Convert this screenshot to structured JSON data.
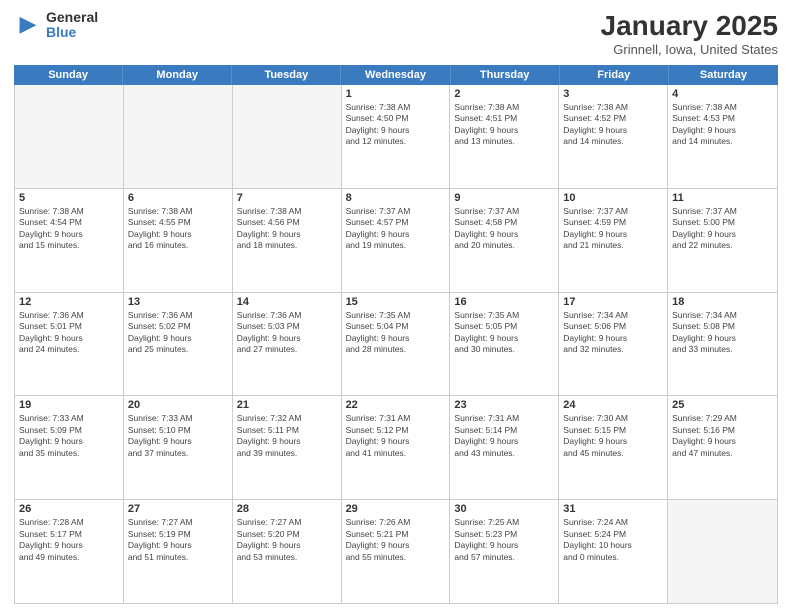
{
  "logo": {
    "general": "General",
    "blue": "Blue"
  },
  "title": "January 2025",
  "subtitle": "Grinnell, Iowa, United States",
  "days": [
    "Sunday",
    "Monday",
    "Tuesday",
    "Wednesday",
    "Thursday",
    "Friday",
    "Saturday"
  ],
  "weeks": [
    [
      {
        "date": "",
        "info": ""
      },
      {
        "date": "",
        "info": ""
      },
      {
        "date": "",
        "info": ""
      },
      {
        "date": "1",
        "info": "Sunrise: 7:38 AM\nSunset: 4:50 PM\nDaylight: 9 hours\nand 12 minutes."
      },
      {
        "date": "2",
        "info": "Sunrise: 7:38 AM\nSunset: 4:51 PM\nDaylight: 9 hours\nand 13 minutes."
      },
      {
        "date": "3",
        "info": "Sunrise: 7:38 AM\nSunset: 4:52 PM\nDaylight: 9 hours\nand 14 minutes."
      },
      {
        "date": "4",
        "info": "Sunrise: 7:38 AM\nSunset: 4:53 PM\nDaylight: 9 hours\nand 14 minutes."
      }
    ],
    [
      {
        "date": "5",
        "info": "Sunrise: 7:38 AM\nSunset: 4:54 PM\nDaylight: 9 hours\nand 15 minutes."
      },
      {
        "date": "6",
        "info": "Sunrise: 7:38 AM\nSunset: 4:55 PM\nDaylight: 9 hours\nand 16 minutes."
      },
      {
        "date": "7",
        "info": "Sunrise: 7:38 AM\nSunset: 4:56 PM\nDaylight: 9 hours\nand 18 minutes."
      },
      {
        "date": "8",
        "info": "Sunrise: 7:37 AM\nSunset: 4:57 PM\nDaylight: 9 hours\nand 19 minutes."
      },
      {
        "date": "9",
        "info": "Sunrise: 7:37 AM\nSunset: 4:58 PM\nDaylight: 9 hours\nand 20 minutes."
      },
      {
        "date": "10",
        "info": "Sunrise: 7:37 AM\nSunset: 4:59 PM\nDaylight: 9 hours\nand 21 minutes."
      },
      {
        "date": "11",
        "info": "Sunrise: 7:37 AM\nSunset: 5:00 PM\nDaylight: 9 hours\nand 22 minutes."
      }
    ],
    [
      {
        "date": "12",
        "info": "Sunrise: 7:36 AM\nSunset: 5:01 PM\nDaylight: 9 hours\nand 24 minutes."
      },
      {
        "date": "13",
        "info": "Sunrise: 7:36 AM\nSunset: 5:02 PM\nDaylight: 9 hours\nand 25 minutes."
      },
      {
        "date": "14",
        "info": "Sunrise: 7:36 AM\nSunset: 5:03 PM\nDaylight: 9 hours\nand 27 minutes."
      },
      {
        "date": "15",
        "info": "Sunrise: 7:35 AM\nSunset: 5:04 PM\nDaylight: 9 hours\nand 28 minutes."
      },
      {
        "date": "16",
        "info": "Sunrise: 7:35 AM\nSunset: 5:05 PM\nDaylight: 9 hours\nand 30 minutes."
      },
      {
        "date": "17",
        "info": "Sunrise: 7:34 AM\nSunset: 5:06 PM\nDaylight: 9 hours\nand 32 minutes."
      },
      {
        "date": "18",
        "info": "Sunrise: 7:34 AM\nSunset: 5:08 PM\nDaylight: 9 hours\nand 33 minutes."
      }
    ],
    [
      {
        "date": "19",
        "info": "Sunrise: 7:33 AM\nSunset: 5:09 PM\nDaylight: 9 hours\nand 35 minutes."
      },
      {
        "date": "20",
        "info": "Sunrise: 7:33 AM\nSunset: 5:10 PM\nDaylight: 9 hours\nand 37 minutes."
      },
      {
        "date": "21",
        "info": "Sunrise: 7:32 AM\nSunset: 5:11 PM\nDaylight: 9 hours\nand 39 minutes."
      },
      {
        "date": "22",
        "info": "Sunrise: 7:31 AM\nSunset: 5:12 PM\nDaylight: 9 hours\nand 41 minutes."
      },
      {
        "date": "23",
        "info": "Sunrise: 7:31 AM\nSunset: 5:14 PM\nDaylight: 9 hours\nand 43 minutes."
      },
      {
        "date": "24",
        "info": "Sunrise: 7:30 AM\nSunset: 5:15 PM\nDaylight: 9 hours\nand 45 minutes."
      },
      {
        "date": "25",
        "info": "Sunrise: 7:29 AM\nSunset: 5:16 PM\nDaylight: 9 hours\nand 47 minutes."
      }
    ],
    [
      {
        "date": "26",
        "info": "Sunrise: 7:28 AM\nSunset: 5:17 PM\nDaylight: 9 hours\nand 49 minutes."
      },
      {
        "date": "27",
        "info": "Sunrise: 7:27 AM\nSunset: 5:19 PM\nDaylight: 9 hours\nand 51 minutes."
      },
      {
        "date": "28",
        "info": "Sunrise: 7:27 AM\nSunset: 5:20 PM\nDaylight: 9 hours\nand 53 minutes."
      },
      {
        "date": "29",
        "info": "Sunrise: 7:26 AM\nSunset: 5:21 PM\nDaylight: 9 hours\nand 55 minutes."
      },
      {
        "date": "30",
        "info": "Sunrise: 7:25 AM\nSunset: 5:23 PM\nDaylight: 9 hours\nand 57 minutes."
      },
      {
        "date": "31",
        "info": "Sunrise: 7:24 AM\nSunset: 5:24 PM\nDaylight: 10 hours\nand 0 minutes."
      },
      {
        "date": "",
        "info": ""
      }
    ]
  ]
}
